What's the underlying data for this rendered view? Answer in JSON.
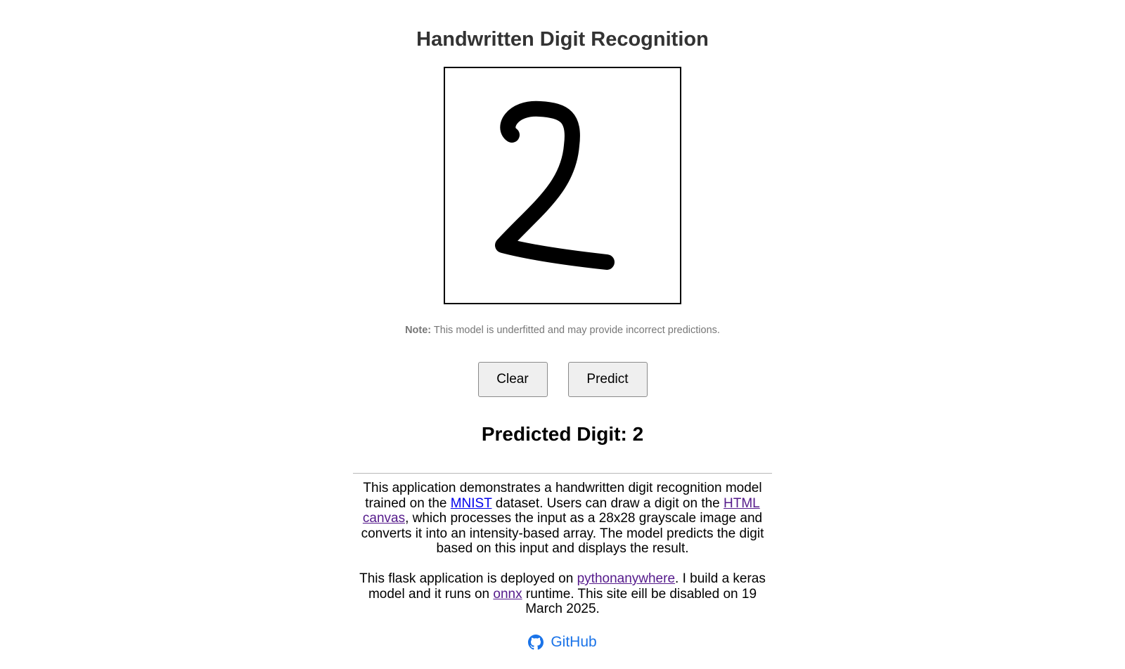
{
  "header": {
    "title": "Handwritten Digit Recognition"
  },
  "note": {
    "label": "Note:",
    "text": " This model is underfitted and may provide incorrect predictions."
  },
  "buttons": {
    "clear_label": "Clear",
    "predict_label": "Predict"
  },
  "result": {
    "label": "Predicted Digit: ",
    "digit": "2"
  },
  "description": {
    "p1_part1": "This application demonstrates a handwritten digit recognition model trained on the ",
    "p1_link_mnist": "MNIST",
    "p1_part2": " dataset. Users can draw a digit on the ",
    "p1_link_canvas": "HTML canvas",
    "p1_part3": ", which processes the input as a 28x28 grayscale image and converts it into an intensity-based array. The model predicts the digit based on this input and displays the result.",
    "p2_part1": "This flask application is deployed on ",
    "p2_link_pa": "pythonanywhere",
    "p2_part2": ". I build a keras model and it runs on ",
    "p2_link_onnx": "onnx",
    "p2_part3": " runtime. This site eill be disabled on 19 March 2025."
  },
  "footer": {
    "github_label": "GitHub",
    "github_icon": "github-icon"
  },
  "colors": {
    "title": "#333333",
    "note": "#777777",
    "link_unvisited": "#0000ee",
    "link_visited": "#551a8b",
    "github_link": "#1a73e8",
    "button_bg": "#efefef"
  }
}
